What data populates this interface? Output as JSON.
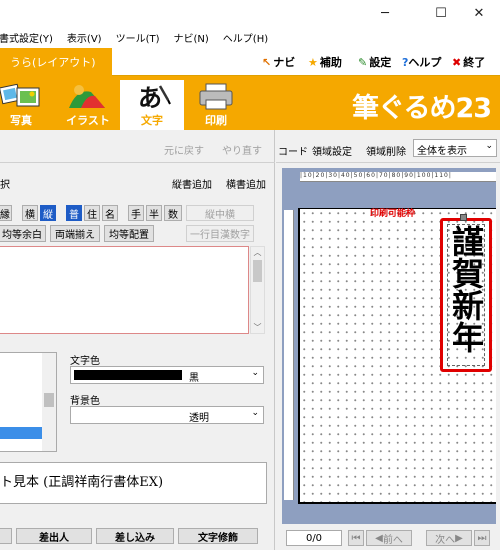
{
  "titlebar": {
    "minimize": "─",
    "maximize": "☐",
    "close": "✕"
  },
  "menu": [
    "書式設定(Y)",
    "表示(V)",
    "ツール(T)",
    "ナビ(N)",
    "ヘルプ(H)"
  ],
  "help_links": {
    "navi": "ナビ",
    "hojo": "補助",
    "settei": "設定",
    "help": "ヘルプ",
    "shuryo": "終了"
  },
  "active_tab": "うら(レイアウト)",
  "ribbon_tabs": [
    {
      "label": "写真",
      "icon": "photo-icon"
    },
    {
      "label": "イラスト",
      "icon": "illustration-icon"
    },
    {
      "label": "文字",
      "icon": "text-icon"
    },
    {
      "label": "印刷",
      "icon": "printer-icon"
    }
  ],
  "logo": "筆ぐるめ23",
  "left": {
    "undo": "元に戻す",
    "redo": "やり直す",
    "select_label": "択",
    "vertical_add": "縦書追加",
    "horizontal_add": "横書追加",
    "row1": [
      "縁",
      "横",
      "縦",
      "普",
      "住",
      "名",
      "手",
      "半",
      "数"
    ],
    "vertical_middle": "縦中横",
    "row2": [
      "均等余白",
      "両端揃え",
      "均等配置"
    ],
    "one_line_kanji": "一行目漢数字",
    "text_color_label": "文字色",
    "text_color_value": "黒",
    "bg_color_label": "背景色",
    "bg_color_value": "透明",
    "font_sample": "ト見本 (正調祥南行書体EX)",
    "bottom_buttons": [
      "差出人",
      "差し込み",
      "文字修飾"
    ]
  },
  "right": {
    "record": "コード",
    "area_settings": "領域設定",
    "area_delete": "領域削除",
    "view_select": "全体を表示",
    "print_area": "印刷可能枠",
    "greeting_chars": [
      "謹",
      "賀",
      "新",
      "年"
    ],
    "page_counter": "0/0",
    "prev": "前へ",
    "next": "次へ"
  },
  "colors": {
    "accent": "#f5a800",
    "selection": "#1e5cc6",
    "frame_red": "#e00000"
  }
}
